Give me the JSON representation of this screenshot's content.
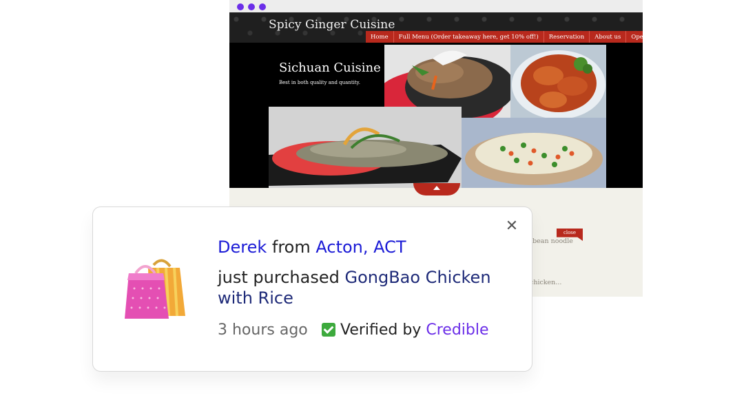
{
  "browser": {
    "window_dots_color": "#6b2ee8"
  },
  "site": {
    "title": "Spicy Ginger Cuisine",
    "nav": [
      "Home",
      "Full Menu (Order takeaway here, get 10% off!)",
      "Reservation",
      "About us",
      "Open Hours"
    ],
    "banner_title": "Sichuan Cuisine",
    "banner_subtitle": "Best in both quality and quantity.",
    "partial_text_1": "g bean noodle",
    "partial_text_2": "chicken...",
    "close_label": "close",
    "accent_color": "#b8291d"
  },
  "notification": {
    "name": "Derek",
    "from_word": "from",
    "location": "Acton, ACT",
    "action": "just purchased",
    "product_line1": "GongBao Chicken",
    "product_line2": "with Rice",
    "time_ago": "3 hours ago",
    "verified_label": "Verified by",
    "verified_brand": "Credible",
    "close_icon": "close-icon",
    "bag_icon": "shopping-bags-icon"
  }
}
